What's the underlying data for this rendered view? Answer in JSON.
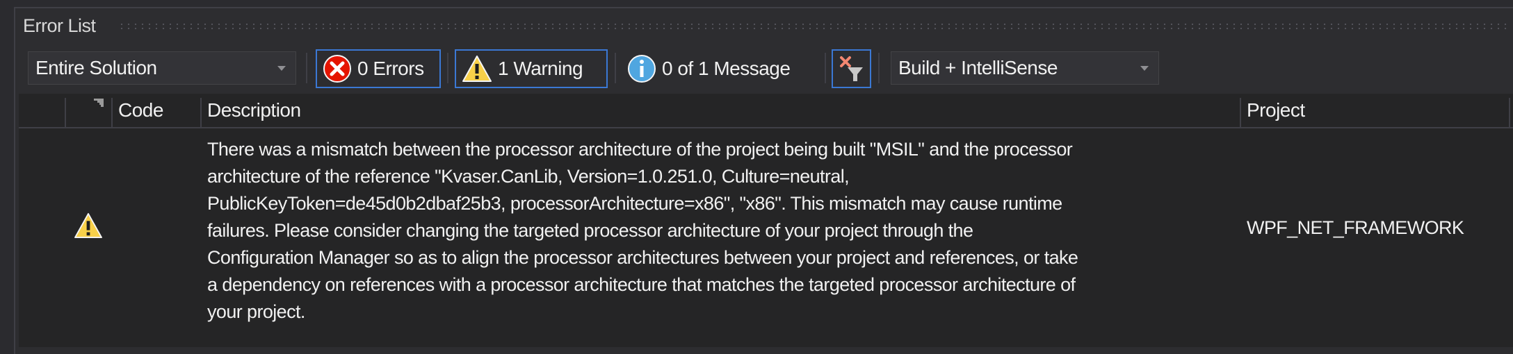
{
  "panel": {
    "title": "Error List"
  },
  "toolbar": {
    "scope_dropdown": {
      "selected": "Entire Solution"
    },
    "errors_button": {
      "label": "0 Errors",
      "icon": "error-icon",
      "active": true
    },
    "warnings_button": {
      "label": "1 Warning",
      "icon": "warning-icon",
      "active": true
    },
    "messages_button": {
      "label": "0 of 1 Message",
      "icon": "info-icon",
      "active": false
    },
    "clear_filter_button": {
      "icon": "clear-filter-icon",
      "active": true
    },
    "source_dropdown": {
      "selected": "Build + IntelliSense"
    }
  },
  "table": {
    "columns": [
      {
        "key": "severity",
        "label": ""
      },
      {
        "key": "suppression",
        "label": ""
      },
      {
        "key": "code",
        "label": "Code"
      },
      {
        "key": "description",
        "label": "Description"
      },
      {
        "key": "project",
        "label": "Project"
      }
    ],
    "rows": [
      {
        "severity_icon": "warning-icon",
        "code": "",
        "description": "There was a mismatch between the processor architecture of the project being built \"MSIL\" and the processor\narchitecture of the reference \"Kvaser.CanLib, Version=1.0.251.0, Culture=neutral,\nPublicKeyToken=de45d0b2dbaf25b3, processorArchitecture=x86\", \"x86\". This mismatch may cause runtime\nfailures. Please consider changing the targeted processor architecture of your project through the\nConfiguration Manager so as to align the processor architectures between your project and references, or take\na dependency on references with a processor architecture that matches the targeted processor architecture of\nyour project.",
        "project": "WPF_NET_FRAMEWORK"
      }
    ]
  },
  "colors": {
    "accent_border": "#3b78d4",
    "error_red": "#e51400",
    "warning_yellow": "#f8d049",
    "info_blue": "#4fa6e0",
    "clear_filter_x": "#f48771"
  }
}
